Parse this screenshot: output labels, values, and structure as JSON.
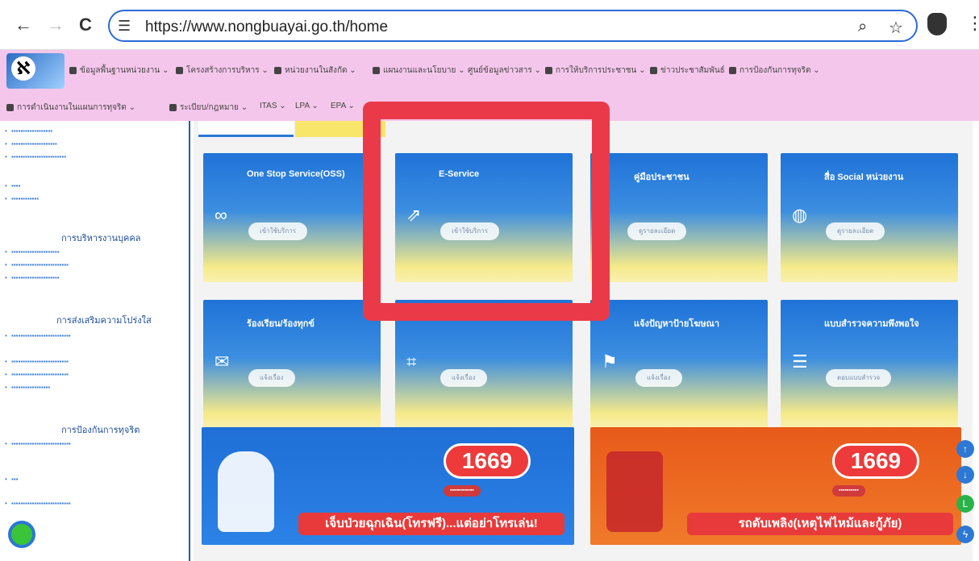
{
  "browser": {
    "url": "https://www.nongbuayai.go.th/home",
    "back": "←",
    "forward": "→",
    "reload": "C"
  },
  "nav_row1": [
    "ข้อมูลพื้นฐานหน่วยงาน",
    "โครงสร้างการบริหาร",
    "หน่วยงานในสังกัด",
    "แผนงานและนโยบาย",
    "ศูนย์ข้อมูลข่าวสาร",
    "การให้บริการประชาชน",
    "ข่าวประชาสัมพันธ์",
    "การป้องกันการทุจริต"
  ],
  "nav_row2": [
    "การดำเนินงานในแผนการทุจริต",
    "ระเบียบ/กฎหมาย",
    "ITAS",
    "LPA",
    "EPA"
  ],
  "sidebar": {
    "h1": "การบริหารงานบุคคล",
    "h2": "การส่งเสริมความโปร่งใส",
    "h3": "การป้องกันการทุจริต"
  },
  "cards": [
    {
      "title": "One Stop Service(OSS)",
      "button": "เข้าใช้บริการ"
    },
    {
      "title": "E-Service",
      "button": "เข้าใช้บริการ"
    },
    {
      "title": "คู่มือประชาชน",
      "button": "ดูรายละเอียด"
    },
    {
      "title": "สื่อ Social หน่วยงาน",
      "button": "ดูรายละเอียด"
    },
    {
      "title": "ร้องเรียน/ร้องทุกข์",
      "button": "แจ้งเรื่อง"
    },
    {
      "title": "",
      "button": "แจ้งเรื่อง"
    },
    {
      "title": "แจ้งปัญหาป้ายโฆษณา",
      "button": "แจ้งเรื่อง"
    },
    {
      "title": "แบบสำรวจความพึงพอใจ",
      "button": "ตอบแบบสำรวจ"
    }
  ],
  "banners": [
    {
      "number": "1669",
      "caption": "เจ็บป่วยฉุกเฉิน(โทรฟรี)...แต่อย่าโทรเล่น!"
    },
    {
      "number": "1669",
      "caption": "รถดับเพลิง(เหตุไฟไหม้และกู้ภัย)"
    }
  ]
}
